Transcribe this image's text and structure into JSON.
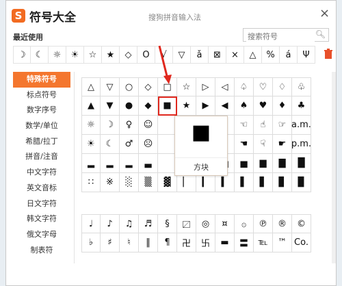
{
  "window": {
    "logo_letter": "S",
    "title": "符号大全",
    "subtitle": "搜狗拼音输入法",
    "close_glyph": "×"
  },
  "recent": {
    "label": "最近使用",
    "symbols": [
      "☽",
      "☾",
      "☼",
      "☀",
      "☆",
      "★",
      "◇",
      "O",
      "√",
      "▽",
      "ǎ",
      "⊠",
      "×",
      "△",
      "%",
      "á",
      "Ψ"
    ]
  },
  "search": {
    "placeholder": "搜索符号",
    "icon": "search-icon"
  },
  "trash_icon": "trash-icon",
  "categories": [
    {
      "label": "特殊符号",
      "active": true
    },
    {
      "label": "标点符号"
    },
    {
      "label": "数字序号"
    },
    {
      "label": "数学/单位"
    },
    {
      "label": "希腊/拉丁"
    },
    {
      "label": "拼音/注音"
    },
    {
      "label": "中文字符"
    },
    {
      "label": "英文音标"
    },
    {
      "label": "日文字符"
    },
    {
      "label": "韩文字符"
    },
    {
      "label": "俄文字母"
    },
    {
      "label": "制表符"
    }
  ],
  "grid_top": [
    [
      "△",
      "▽",
      "○",
      "◇",
      "□",
      "☆",
      "▷",
      "◁",
      "♤",
      "♡",
      "♢",
      "♧"
    ],
    [
      "▲",
      "▼",
      "●",
      "◆",
      "■",
      "★",
      "▶",
      "◀",
      "♠",
      "♥",
      "♦",
      "♣"
    ],
    [
      "☼",
      "☽",
      "♀",
      "☺",
      "",
      "",
      "",
      "✔",
      "☜",
      "☝",
      "☞",
      "a.m."
    ],
    [
      "☀",
      "☾",
      "♂",
      "☹",
      "",
      "",
      "",
      "✘",
      "☚",
      "☟",
      "☛",
      "p.m."
    ],
    [
      "▂",
      "▂",
      "▂",
      "▃",
      "",
      "",
      "",
      "▅",
      "▅",
      "▆",
      "▇",
      "█"
    ],
    [
      "∷",
      "※",
      "░",
      "▒",
      "▓",
      "▏",
      "▎",
      "▍",
      "▌",
      "▋",
      "▊",
      "▉"
    ]
  ],
  "grid_bottom": [
    [
      "♩",
      "♪",
      "♫",
      "♬",
      "§",
      "〼",
      "◎",
      "¤",
      "۞",
      "℗",
      "®",
      "©"
    ],
    [
      "♭",
      "♯",
      "♮",
      "‖",
      "¶",
      "卍",
      "卐",
      "▬",
      "〓",
      "℡",
      "™",
      "Co."
    ]
  ],
  "tooltip": {
    "symbol": "■",
    "name": "方块"
  }
}
